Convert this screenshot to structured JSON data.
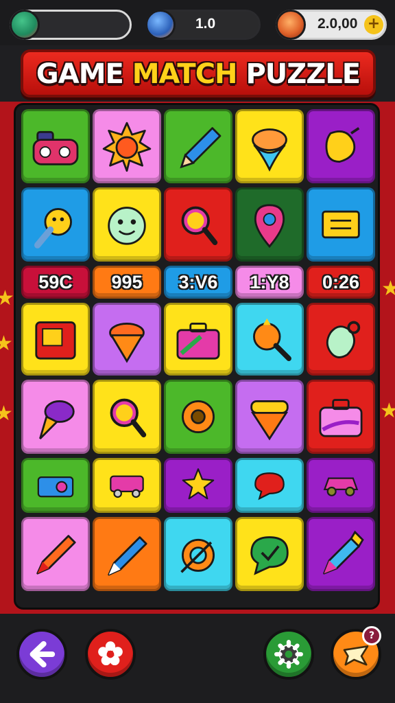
{
  "hud": {
    "level_value": "1.0",
    "coins_value": "2.0,00",
    "coin_add_symbol": "+"
  },
  "title": {
    "part1": "GAME ",
    "part2": "MATCH",
    "part3": " PUZZLE"
  },
  "colors": {
    "green": "#4cb82a",
    "pink": "#f58be8",
    "yellow": "#ffe21a",
    "purple": "#9a1fc7",
    "blue": "#1f9ce6",
    "red": "#e0201c",
    "darkgreen": "#1f6b2a",
    "cyan": "#3fd7f0",
    "violet": "#c56df0",
    "orange": "#ff7a14",
    "crimson": "#c8103a"
  },
  "board": {
    "rows": [
      [
        {
          "color": "green",
          "icon": "gamepad-icon"
        },
        {
          "color": "pink",
          "icon": "sun-icon"
        },
        {
          "color": "green",
          "icon": "pencil-icon"
        },
        {
          "color": "yellow",
          "icon": "spinning-top-icon"
        },
        {
          "color": "purple",
          "icon": "balloon-icon"
        }
      ],
      [
        {
          "color": "blue",
          "icon": "cannonball-icon"
        },
        {
          "color": "yellow",
          "icon": "smiley-ball-icon"
        },
        {
          "color": "red",
          "icon": "magnifier-icon"
        },
        {
          "color": "darkgreen",
          "icon": "location-pin-icon"
        },
        {
          "color": "blue",
          "icon": "sign-icon"
        }
      ],
      [
        {
          "color": "crimson",
          "text": "59C"
        },
        {
          "color": "orange",
          "text": "995"
        },
        {
          "color": "blue",
          "text": "3:V6"
        },
        {
          "color": "pink",
          "text": "1:Y8"
        },
        {
          "color": "red",
          "text": "0:26"
        }
      ],
      [
        {
          "color": "yellow",
          "icon": "puzzle-box-icon"
        },
        {
          "color": "violet",
          "icon": "top-gem-icon"
        },
        {
          "color": "yellow",
          "icon": "briefcase-icon"
        },
        {
          "color": "cyan",
          "icon": "sun-wand-icon"
        },
        {
          "color": "red",
          "icon": "bell-bomb-icon"
        }
      ],
      [
        {
          "color": "pink",
          "icon": "ice-cream-icon"
        },
        {
          "color": "yellow",
          "icon": "magnifier-icon"
        },
        {
          "color": "green",
          "icon": "gear-sun-icon"
        },
        {
          "color": "violet",
          "icon": "shield-top-icon"
        },
        {
          "color": "red",
          "icon": "suitcase-icon"
        }
      ],
      [
        {
          "color": "green",
          "icon": "camera-icon"
        },
        {
          "color": "yellow",
          "icon": "truck-icon"
        },
        {
          "color": "purple",
          "icon": "star-icon"
        },
        {
          "color": "cyan",
          "icon": "speech-bubble-icon"
        },
        {
          "color": "purple",
          "icon": "car-icon"
        }
      ],
      [
        {
          "color": "pink",
          "icon": "crayon-icon"
        },
        {
          "color": "orange",
          "icon": "pen-icon"
        },
        {
          "color": "cyan",
          "icon": "target-icon"
        },
        {
          "color": "yellow",
          "icon": "check-bubble-icon"
        },
        {
          "color": "purple",
          "icon": "rocket-crayon-icon"
        }
      ]
    ]
  },
  "bottom": {
    "back_icon": "back-arrow-icon",
    "flower_icon": "flower-icon",
    "settings_icon": "gear-icon",
    "share_icon": "star-share-icon",
    "notification_count": "?"
  }
}
